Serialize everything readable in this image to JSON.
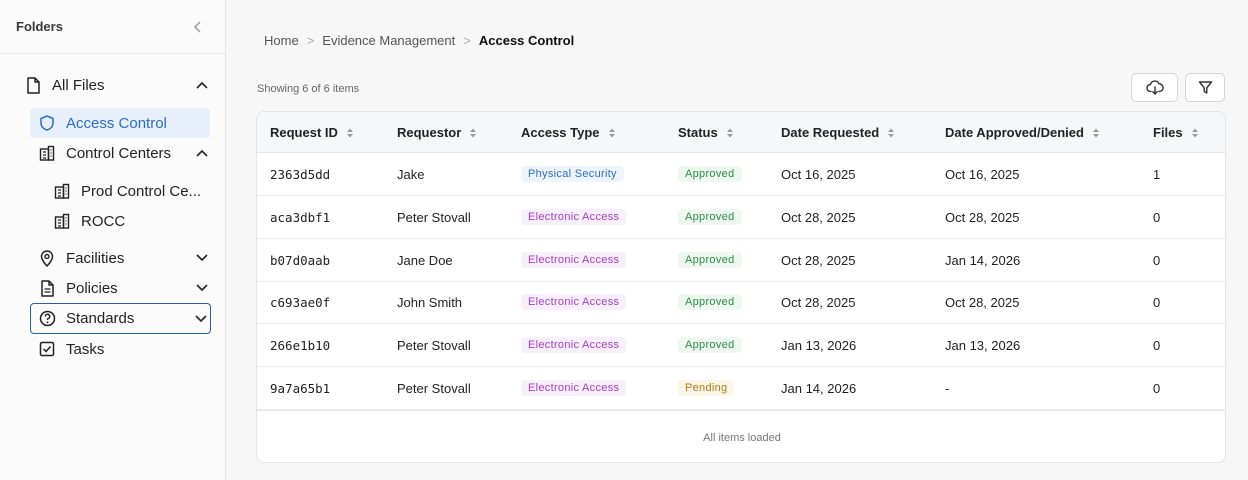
{
  "sidebar": {
    "title": "Folders",
    "items": [
      {
        "label": "All Files",
        "icon": "file-icon"
      },
      {
        "label": "Access Control",
        "icon": "shield-icon"
      },
      {
        "label": "Control Centers",
        "icon": "building-icon"
      },
      {
        "label": "Prod Control Ce...",
        "icon": "building-icon"
      },
      {
        "label": "ROCC",
        "icon": "building-icon"
      },
      {
        "label": "Facilities",
        "icon": "location-pin-icon"
      },
      {
        "label": "Policies",
        "icon": "document-icon"
      },
      {
        "label": "Standards",
        "icon": "question-circle-icon"
      },
      {
        "label": "Tasks",
        "icon": "checkbox-icon"
      }
    ]
  },
  "breadcrumb": {
    "home": "Home",
    "section": "Evidence Management",
    "current": "Access Control",
    "separator": ">"
  },
  "table": {
    "count_text": "Showing 6 of 6 items",
    "columns": [
      "Request ID",
      "Requestor",
      "Access Type",
      "Status",
      "Date Requested",
      "Date Approved/Denied",
      "Files"
    ],
    "rows": [
      {
        "id": "2363d5dd",
        "requestor": "Jake",
        "access_type": "Physical Security",
        "status": "Approved",
        "date_requested": "Oct 16, 2025",
        "date_decided": "Oct 16, 2025",
        "files": "1"
      },
      {
        "id": "aca3dbf1",
        "requestor": "Peter Stovall",
        "access_type": "Electronic Access",
        "status": "Approved",
        "date_requested": "Oct 28, 2025",
        "date_decided": "Oct 28, 2025",
        "files": "0"
      },
      {
        "id": "b07d0aab",
        "requestor": "Jane Doe",
        "access_type": "Electronic Access",
        "status": "Approved",
        "date_requested": "Oct 28, 2025",
        "date_decided": "Jan 14, 2026",
        "files": "0"
      },
      {
        "id": "c693ae0f",
        "requestor": "John Smith",
        "access_type": "Electronic Access",
        "status": "Approved",
        "date_requested": "Oct 28, 2025",
        "date_decided": "Oct 28, 2025",
        "files": "0"
      },
      {
        "id": "266e1b10",
        "requestor": "Peter Stovall",
        "access_type": "Electronic Access",
        "status": "Approved",
        "date_requested": "Jan 13, 2026",
        "date_decided": "Jan 13, 2026",
        "files": "0"
      },
      {
        "id": "9a7a65b1",
        "requestor": "Peter Stovall",
        "access_type": "Electronic Access",
        "status": "Pending",
        "date_requested": "Jan 14, 2026",
        "date_decided": "-",
        "files": "0"
      }
    ],
    "footer": "All items loaded"
  },
  "colors": {
    "accent": "#2c6cc4",
    "active_bg": "#e6effa",
    "approved": "#2e8a4b",
    "pending": "#b07a16",
    "electronic": "#a33fc4"
  }
}
